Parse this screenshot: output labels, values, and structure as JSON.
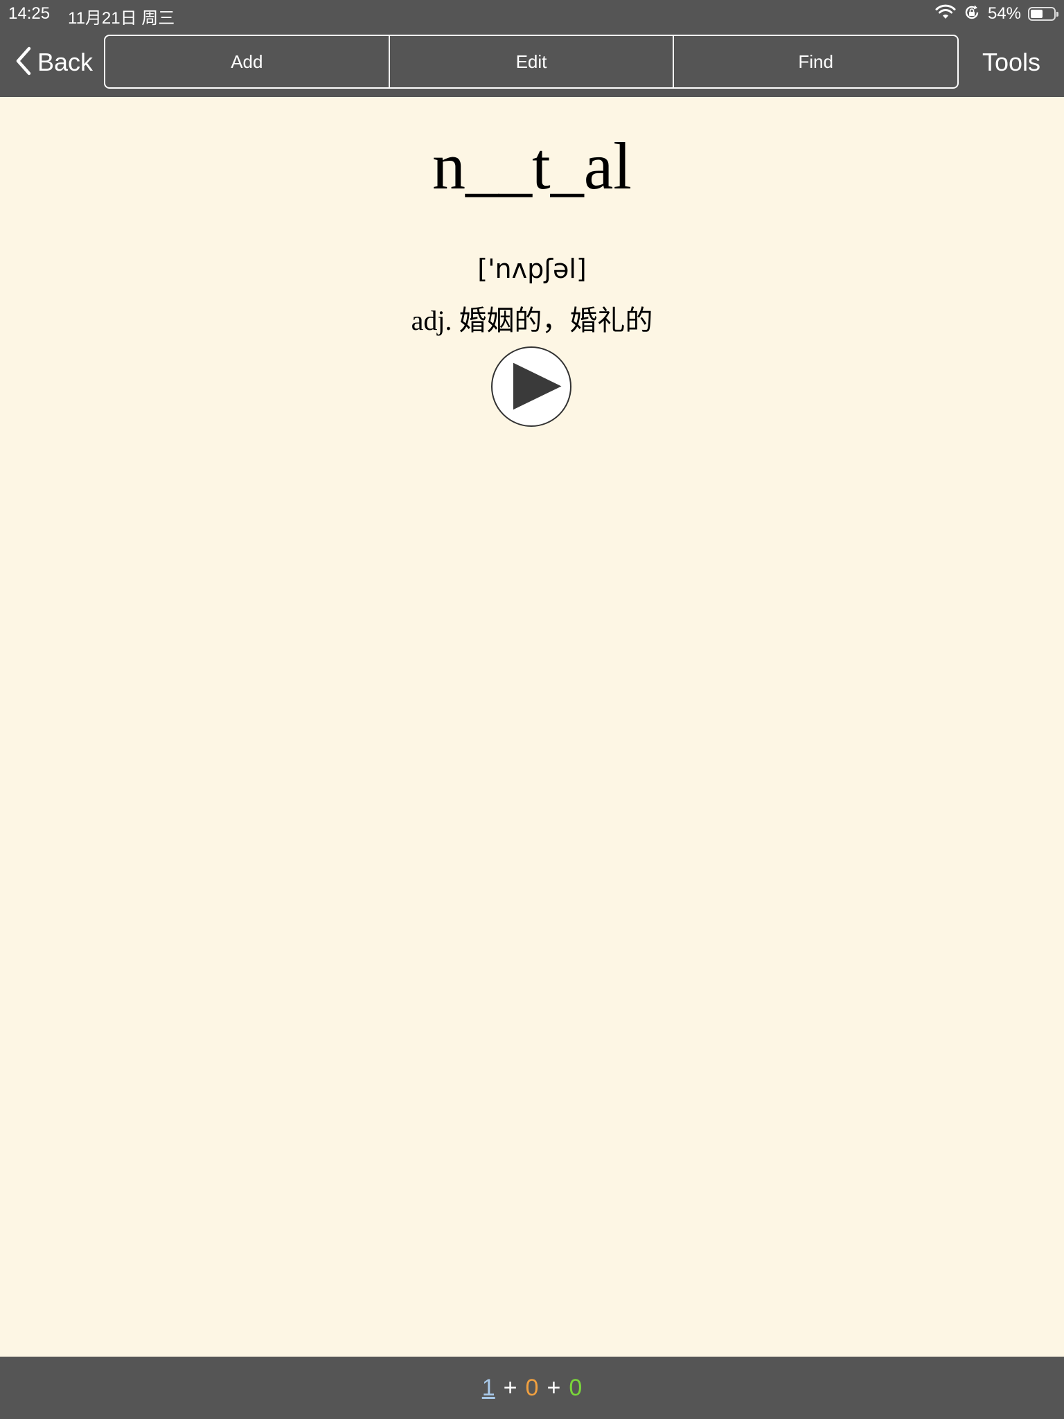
{
  "status_bar": {
    "time": "14:25",
    "date": "11月21日 周三",
    "battery_percent": "54%",
    "battery_level": 0.54,
    "icons": [
      "wifi-icon",
      "orientation-lock-icon",
      "battery-icon"
    ]
  },
  "nav": {
    "back_label": "Back",
    "segments": [
      "Add",
      "Edit",
      "Find"
    ],
    "tools_label": "Tools"
  },
  "card": {
    "word": "n__t_al",
    "phonetic": "['nʌpʃəl]",
    "definition": "adj. 婚姻的，婚礼的",
    "play_icon": "play-icon"
  },
  "footer": {
    "count_a": "1",
    "plus_1": "+",
    "count_b": "0",
    "plus_2": "+",
    "count_c": "0"
  },
  "colors": {
    "bar_background": "#555555",
    "page_background": "#FDF6E4",
    "count_a_color": "#A8C8E8",
    "count_b_color": "#F0A040",
    "count_c_color": "#7AD63A"
  }
}
